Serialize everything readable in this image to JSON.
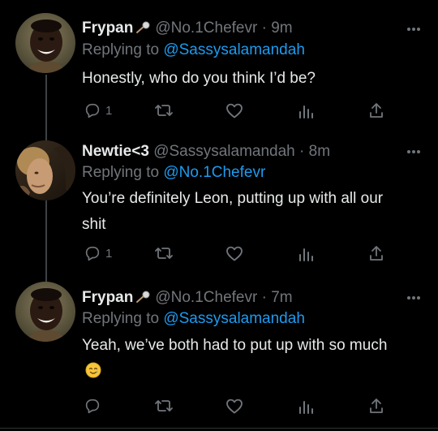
{
  "colors": {
    "background": "#000000",
    "text": "#e7e9ea",
    "muted": "#71767b",
    "link": "#1d9bf0",
    "divider": "#2f3336",
    "thread_line": "#3e4144"
  },
  "tweets": [
    {
      "display_name": "Frypan",
      "name_emoji": "ladle-emoji",
      "handle": "@No.1Chefevr",
      "separator": "·",
      "time": "9m",
      "replying_prefix": "Replying to",
      "replying_to": "@Sassysalamandah",
      "text": "Honestly, who do you think I’d be?",
      "reply_count": "1",
      "avatar": "smiling-man-avatar"
    },
    {
      "display_name": "Newtie<3",
      "handle": "@Sassysalamandah",
      "separator": "·",
      "time": "8m",
      "replying_prefix": "Replying to",
      "replying_to": "@No.1Chefevr",
      "text": "You’re definitely Leon, putting up with all our shit",
      "reply_count": "1",
      "avatar": "blond-boy-avatar"
    },
    {
      "display_name": "Frypan",
      "name_emoji": "ladle-emoji",
      "handle": "@No.1Chefevr",
      "separator": "·",
      "time": "7m",
      "replying_prefix": "Replying to",
      "replying_to": "@Sassysalamandah",
      "text": "Yeah, we’ve both had to put up with so much",
      "text_emoji": "smiling-face-with-tear-emoji",
      "reply_count": "",
      "avatar": "smiling-man-avatar"
    }
  ],
  "icons": {
    "more": "more-icon",
    "reply": "reply-icon",
    "retweet": "retweet-icon",
    "like": "like-icon",
    "analytics": "analytics-icon",
    "share": "share-icon"
  }
}
